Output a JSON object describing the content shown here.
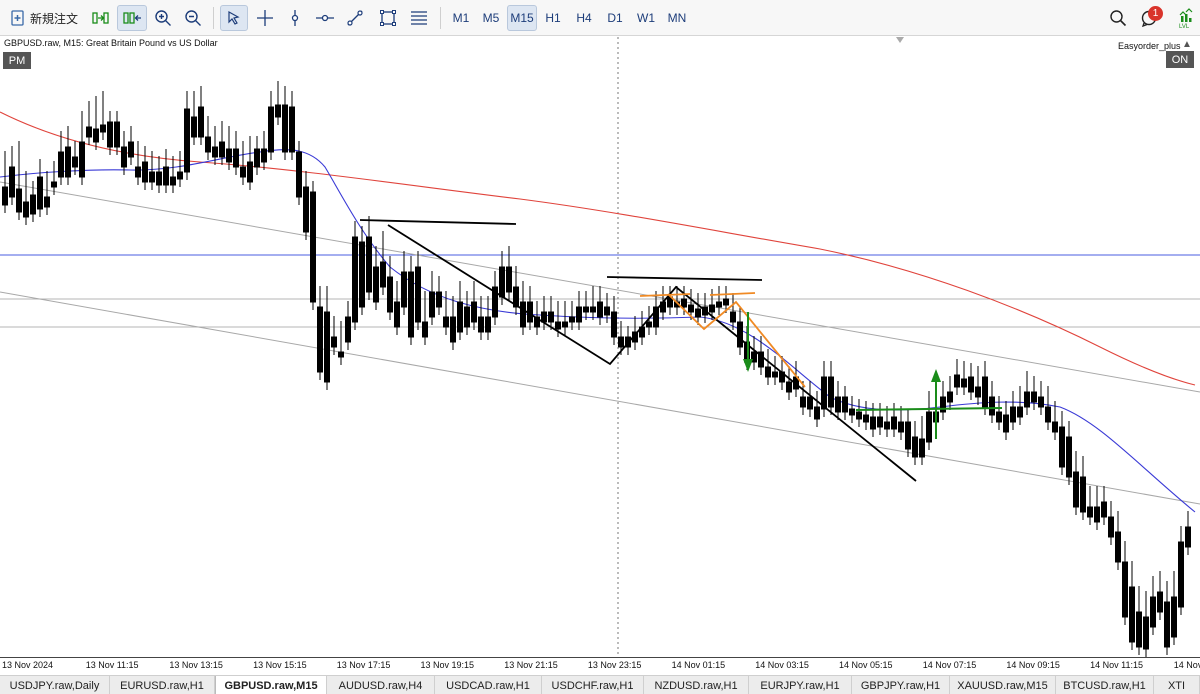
{
  "toolbar": {
    "new_order_label": "新規注文",
    "timeframes": [
      {
        "label": "M1",
        "active": false
      },
      {
        "label": "M5",
        "active": false
      },
      {
        "label": "M15",
        "active": true
      },
      {
        "label": "H1",
        "active": false
      },
      {
        "label": "H4",
        "active": false
      },
      {
        "label": "D1",
        "active": false
      },
      {
        "label": "W1",
        "active": false
      },
      {
        "label": "MN",
        "active": false
      }
    ],
    "notification_count": "1",
    "tools": [
      "new-order-icon",
      "algo-trading-icon",
      "one-click-trading-icon",
      "zoom-in-icon",
      "zoom-out-icon",
      "cursor-icon",
      "crosshair-icon",
      "vertical-line-icon",
      "horizontal-line-icon",
      "trend-line-icon",
      "rectangle-icon",
      "fibonacci-icon"
    ]
  },
  "chart": {
    "title": "GBPUSD.raw, M15:  Great Britain Pound vs US Dollar",
    "session_badge": "PM",
    "ea_name": "Easyorder_plus",
    "ea_status": "ON"
  },
  "time_axis": {
    "labels": [
      "13 Nov 2024",
      "13 Nov 11:15",
      "13 Nov 13:15",
      "13 Nov 15:15",
      "13 Nov 17:15",
      "13 Nov 19:15",
      "13 Nov 21:15",
      "13 Nov 23:15",
      "14 Nov 01:15",
      "14 Nov 03:15",
      "14 Nov 05:15",
      "14 Nov 07:15",
      "14 Nov 09:15",
      "14 Nov 11:15",
      "14 Nov"
    ]
  },
  "tabs": [
    {
      "label": "USDJPY.raw,Daily",
      "active": false
    },
    {
      "label": "EURUSD.raw,H1",
      "active": false
    },
    {
      "label": "GBPUSD.raw,M15",
      "active": true
    },
    {
      "label": "AUDUSD.raw,H4",
      "active": false
    },
    {
      "label": "USDCAD.raw,H1",
      "active": false
    },
    {
      "label": "USDCHF.raw,H1",
      "active": false
    },
    {
      "label": "NZDUSD.raw,H1",
      "active": false
    },
    {
      "label": "EURJPY.raw,H1",
      "active": false
    },
    {
      "label": "GBPJPY.raw,H1",
      "active": false
    },
    {
      "label": "XAUUSD.raw,M15",
      "active": false
    },
    {
      "label": "BTCUSD.raw,H1",
      "active": false
    },
    {
      "label": "XTI",
      "active": false
    }
  ],
  "colors": {
    "ma_fast": "#3a3ad6",
    "ma_slow": "#e0443c",
    "level_line": "#4a5de0",
    "zigzag": "#000000",
    "pattern": "#f08a24",
    "signal": "#1a8c1a"
  }
}
